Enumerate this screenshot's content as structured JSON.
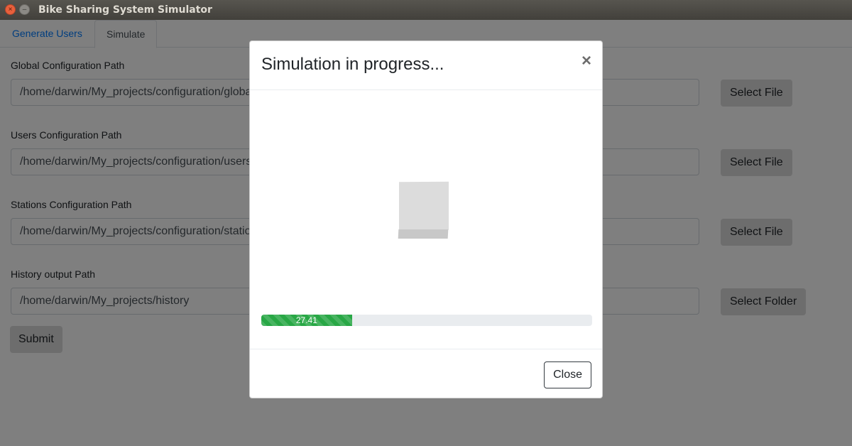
{
  "window": {
    "title": "Bike Sharing System Simulator",
    "close_glyph": "×",
    "minimize_glyph": "–"
  },
  "tabs": [
    {
      "label": "Generate Users",
      "active": false
    },
    {
      "label": "Simulate",
      "active": true
    }
  ],
  "form": {
    "fields": [
      {
        "label": "Global Configuration Path",
        "value": "/home/darwin/My_projects/configuration/global_configuration.json",
        "button": "Select File"
      },
      {
        "label": "Users Configuration Path",
        "value": "/home/darwin/My_projects/configuration/users_configuration.json",
        "button": "Select File"
      },
      {
        "label": "Stations Configuration Path",
        "value": "/home/darwin/My_projects/configuration/stations_configuration.json",
        "button": "Select File"
      },
      {
        "label": "History output Path",
        "value": "/home/darwin/My_projects/history",
        "button": "Select Folder"
      }
    ],
    "submit_label": "Submit"
  },
  "modal": {
    "title": "Simulation in progress...",
    "close_x": "×",
    "progress_value": 27.41,
    "progress_text": "27.41",
    "progress_color": "#28a745",
    "close_label": "Close"
  },
  "colors": {
    "link": "#007bff",
    "titlebar": "#4a4843",
    "button_bg": "#dadada"
  }
}
